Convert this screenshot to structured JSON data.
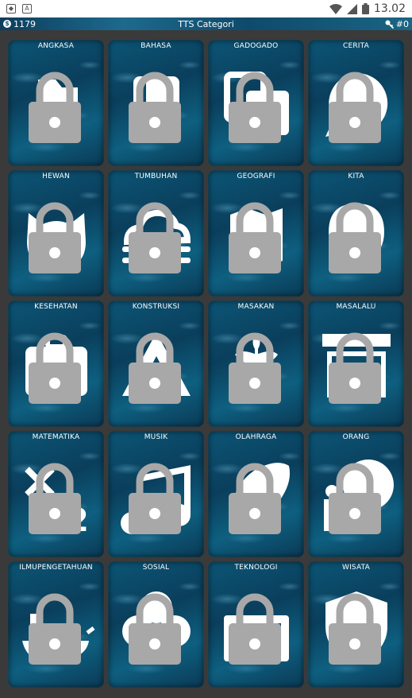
{
  "status_bar": {
    "time": "13.02",
    "notification_icons": [
      "shield-icon",
      "font-icon"
    ],
    "system_icons": [
      "wifi-icon",
      "signal-icon",
      "battery-icon"
    ]
  },
  "app_bar": {
    "coins": "1179",
    "title": "TTS Categori",
    "keys": "#0"
  },
  "colors": {
    "tile_base": "#0a4a6a",
    "lock": "#a8a8a8",
    "icon": "#ffffff"
  },
  "categories": [
    {
      "label": "ANGKASA",
      "icon": "flag-icon"
    },
    {
      "label": "BAHASA",
      "icon": "book-icon"
    },
    {
      "label": "GADOGADO",
      "icon": "copy-icon"
    },
    {
      "label": "CERITA",
      "icon": "chat-bubble-icon"
    },
    {
      "label": "HEWAN",
      "icon": "cat-icon"
    },
    {
      "label": "TUMBUHAN",
      "icon": "fog-cloud-icon"
    },
    {
      "label": "GEOGRAFI",
      "icon": "map-icon"
    },
    {
      "label": "KITA",
      "icon": "face-icon"
    },
    {
      "label": "KESEHATAN",
      "icon": "medical-bag-icon"
    },
    {
      "label": "KONSTRUKSI",
      "icon": "triangle-icon"
    },
    {
      "label": "MASAKAN",
      "icon": "wheat-icon"
    },
    {
      "label": "MASALALU",
      "icon": "archive-icon"
    },
    {
      "label": "MATEMATIKA",
      "icon": "math-icon"
    },
    {
      "label": "MUSIK",
      "icon": "music-note-icon"
    },
    {
      "label": "OLAHRAGA",
      "icon": "football-icon"
    },
    {
      "label": "ORANG",
      "icon": "person-icon"
    },
    {
      "label": "ILMUPENGETAHUAN",
      "icon": "ship-icon"
    },
    {
      "label": "SOSIAL",
      "icon": "flower-icon"
    },
    {
      "label": "TEKNOLOGI",
      "icon": "film-icon"
    },
    {
      "label": "WISATA",
      "icon": "shield-icon"
    }
  ]
}
